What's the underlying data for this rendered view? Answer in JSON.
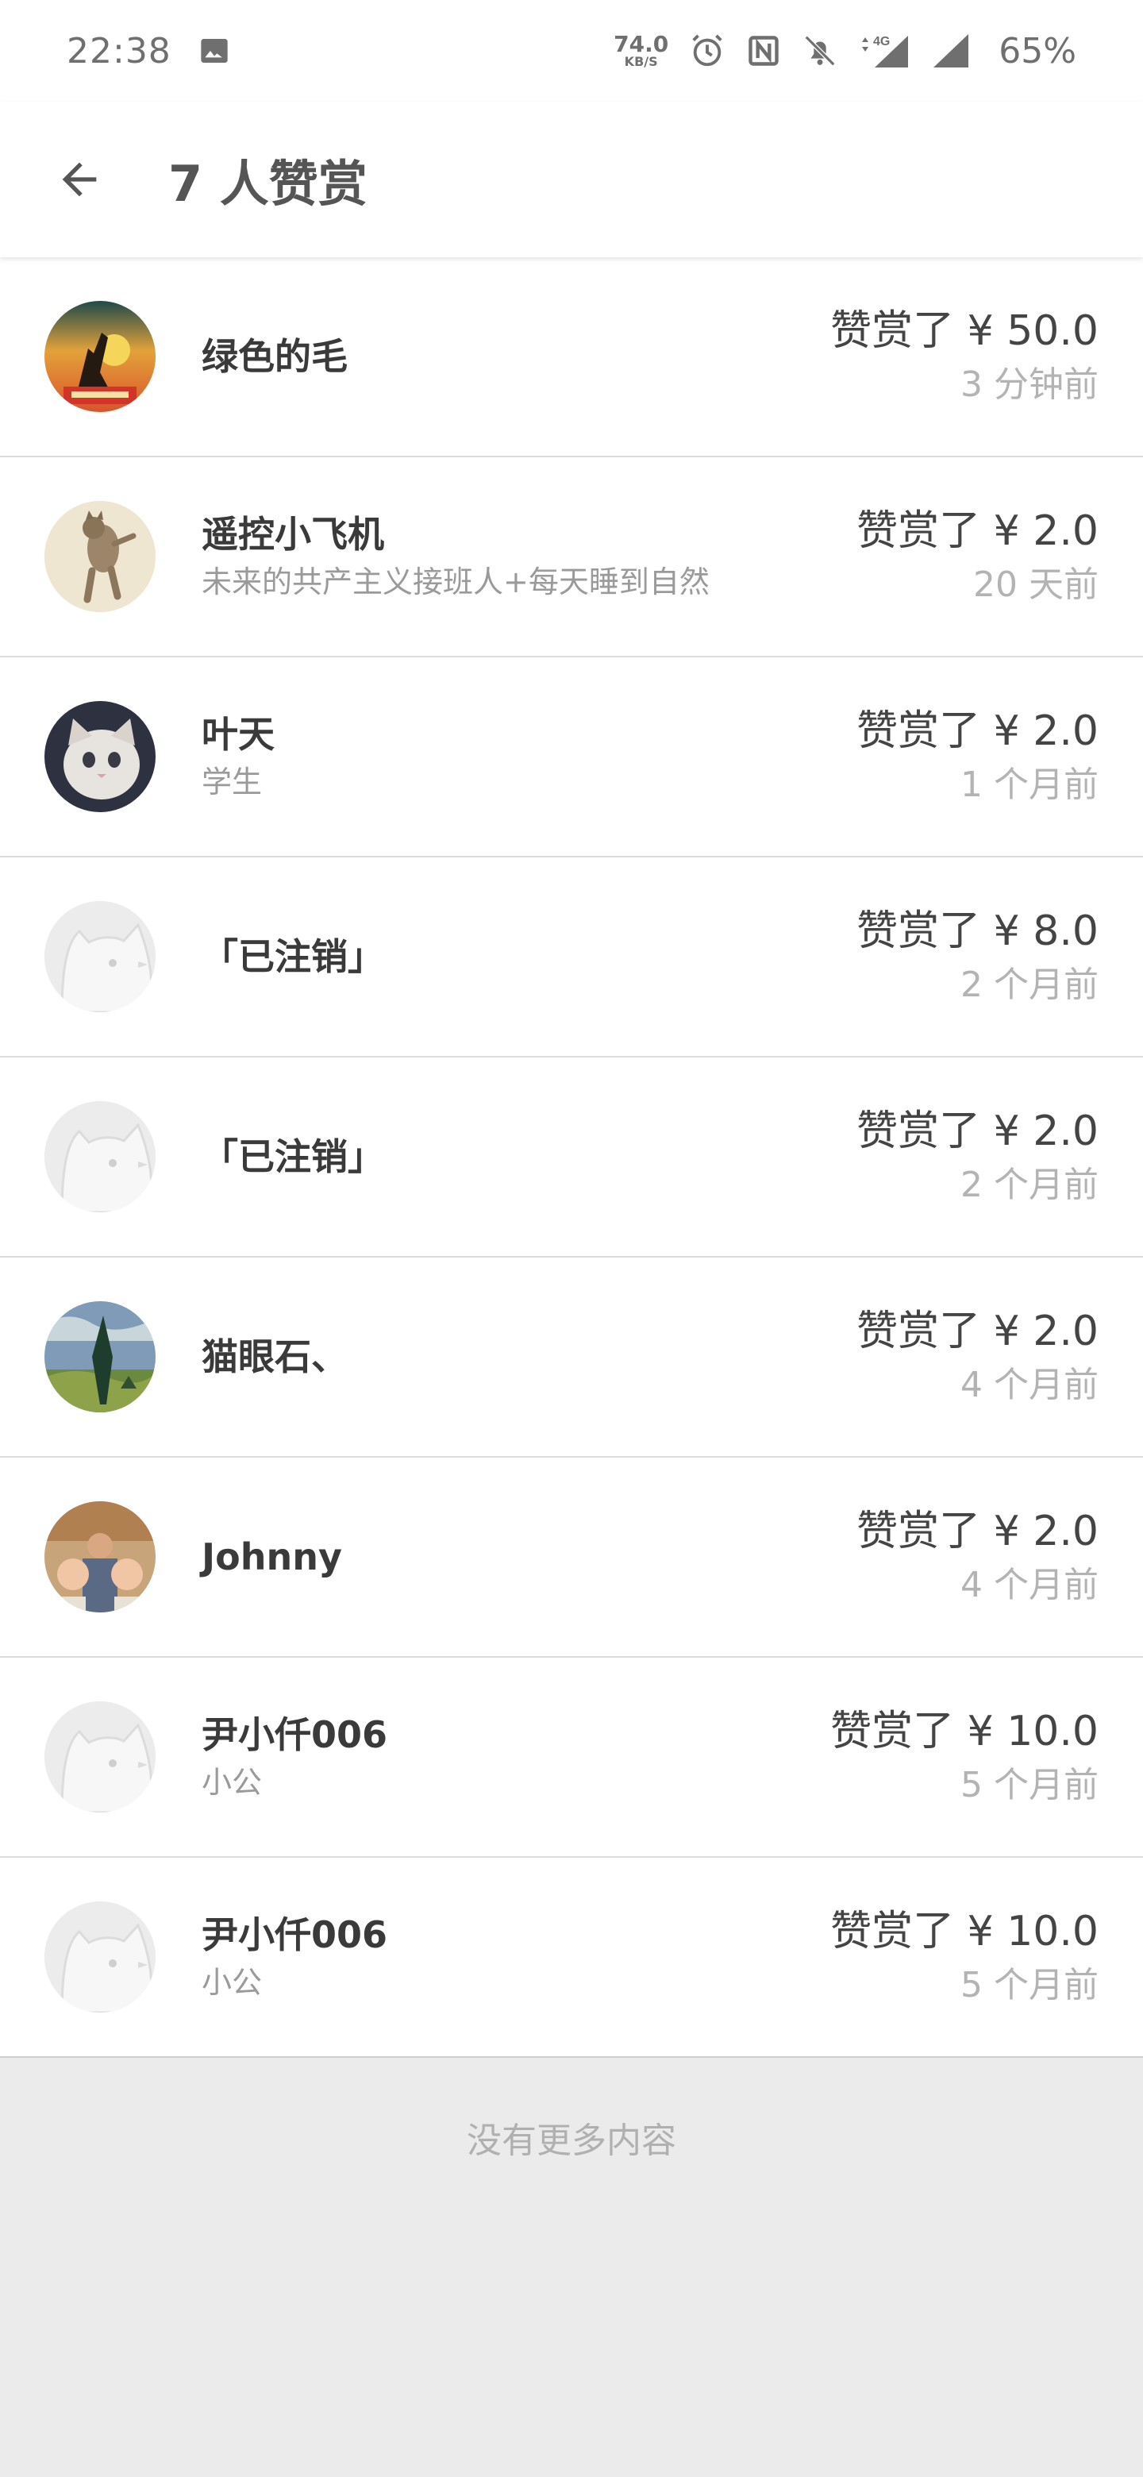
{
  "status_bar": {
    "time": "22:38",
    "net_speed_value": "74.0",
    "net_speed_unit": "KB/S",
    "network": "4G",
    "battery": "65%",
    "icons": [
      "image-icon",
      "alarm-icon",
      "nfc-icon",
      "bell-off-icon",
      "signal-icon",
      "signal-icon"
    ]
  },
  "header": {
    "title": "7 人赞赏"
  },
  "rewards": [
    {
      "name": "绿色的毛",
      "subtitle": "",
      "amount": "赞赏了 ¥ 50.0",
      "time": "3 分钟前",
      "avatar": "photo-sunset"
    },
    {
      "name": "遥控小飞机",
      "subtitle": "未来的共产主义接班人+每天睡到自然",
      "amount": "赞赏了 ¥ 2.0",
      "time": "20 天前",
      "avatar": "photo-cat-standing"
    },
    {
      "name": "叶天",
      "subtitle": "学生",
      "amount": "赞赏了 ¥ 2.0",
      "time": "1 个月前",
      "avatar": "photo-cat-face"
    },
    {
      "name": "「已注销」",
      "subtitle": "",
      "amount": "赞赏了 ¥ 8.0",
      "time": "2 个月前",
      "avatar": "default"
    },
    {
      "name": "「已注销」",
      "subtitle": "",
      "amount": "赞赏了 ¥ 2.0",
      "time": "2 个月前",
      "avatar": "default"
    },
    {
      "name": "猫眼石、",
      "subtitle": "",
      "amount": "赞赏了 ¥ 2.0",
      "time": "4 个月前",
      "avatar": "photo-painting"
    },
    {
      "name": "Johnny",
      "subtitle": "",
      "amount": "赞赏了 ¥ 2.0",
      "time": "4 个月前",
      "avatar": "photo-family"
    },
    {
      "name": "尹小仟006",
      "subtitle": "小公",
      "amount": "赞赏了 ¥ 10.0",
      "time": "5 个月前",
      "avatar": "default"
    },
    {
      "name": "尹小仟006",
      "subtitle": "小公",
      "amount": "赞赏了 ¥ 10.0",
      "time": "5 个月前",
      "avatar": "default"
    }
  ],
  "footer": {
    "message": "没有更多内容"
  }
}
